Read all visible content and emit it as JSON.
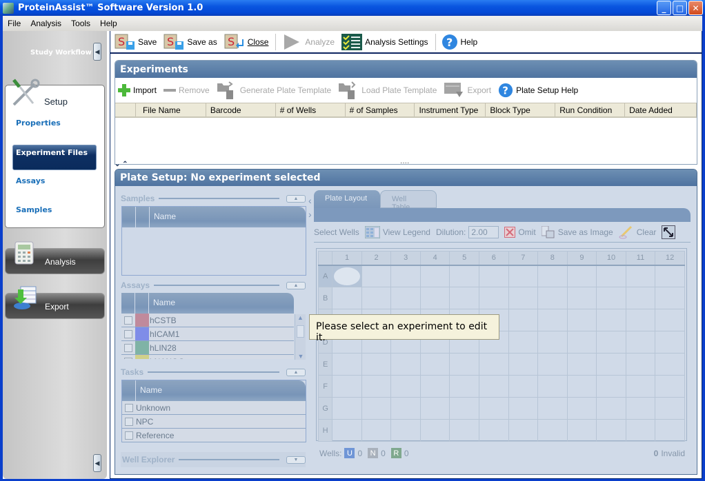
{
  "window": {
    "title": "ProteinAssist™ Software Version 1.0",
    "minimize": "_",
    "maximize": "□",
    "close": "✕"
  },
  "menu": [
    "File",
    "Analysis",
    "Tools",
    "Help"
  ],
  "sidebar": {
    "title": "Study Workflow",
    "collapse_glyph": "◀",
    "setup_label": "Setup",
    "links": [
      "Properties",
      "Experiment Files",
      "Assays",
      "Samples"
    ],
    "active_link": "Experiment Files",
    "analysis_label": "Analysis",
    "export_label": "Export"
  },
  "toolbar": {
    "save": "Save",
    "save_as": "Save as",
    "close": "Close",
    "analyze": "Analyze",
    "analysis_settings": "Analysis Settings",
    "help": "Help"
  },
  "experiments": {
    "title": "Experiments",
    "actions": {
      "import": "Import",
      "remove": "Remove",
      "generate_template": "Generate Plate Template",
      "load_template": "Load Plate Template",
      "export": "Export",
      "help": "Plate Setup Help"
    },
    "columns": [
      "File Name",
      "Barcode",
      "# of Wells",
      "# of Samples",
      "Instrument Type",
      "Block Type",
      "Run Condition",
      "Date Added"
    ],
    "rows": [],
    "splitter_glyphs": "⌄ ⌃",
    "splitter_dots": "····"
  },
  "plate_setup": {
    "title": "Plate Setup: No experiment selected",
    "samples": {
      "title": "Samples",
      "column": "Name",
      "items": []
    },
    "assays": {
      "title": "Assays",
      "column": "Name",
      "items": [
        {
          "name": "hCSTB",
          "color": "#c08a9c"
        },
        {
          "name": "hICAM1",
          "color": "#7f8de8"
        },
        {
          "name": "hLIN28",
          "color": "#7fb3a6"
        },
        {
          "name": "hNANOG",
          "color": "#d0d08a"
        }
      ]
    },
    "tasks": {
      "title": "Tasks",
      "column": "Name",
      "items": [
        "Unknown",
        "NPC",
        "Reference"
      ]
    },
    "well_explorer": {
      "title": "Well Explorer"
    },
    "tabs": [
      "Plate Layout",
      "Well Table"
    ],
    "active_tab": "Plate Layout",
    "tools": {
      "select_wells": "Select Wells",
      "view_legend": "View Legend",
      "dilution_label": "Dilution:",
      "dilution_value": "2.00",
      "omit": "Omit",
      "save_image": "Save as Image",
      "clear": "Clear"
    },
    "columns": [
      "1",
      "2",
      "3",
      "4",
      "5",
      "6",
      "7",
      "8",
      "9",
      "10",
      "11",
      "12"
    ],
    "rows": [
      "A",
      "B",
      "C",
      "D",
      "E",
      "F",
      "G",
      "H"
    ],
    "selected_well": "A1",
    "wells_footer": {
      "label": "Wells:",
      "counts": [
        {
          "letter": "U",
          "count": "0",
          "color": "#6f95d6"
        },
        {
          "letter": "N",
          "count": "0",
          "color": "#a9b1bc"
        },
        {
          "letter": "R",
          "count": "0",
          "color": "#7fa88e"
        }
      ],
      "invalid_count": "0",
      "invalid_label": "Invalid"
    }
  },
  "tooltip": "Please select an experiment to edit it."
}
